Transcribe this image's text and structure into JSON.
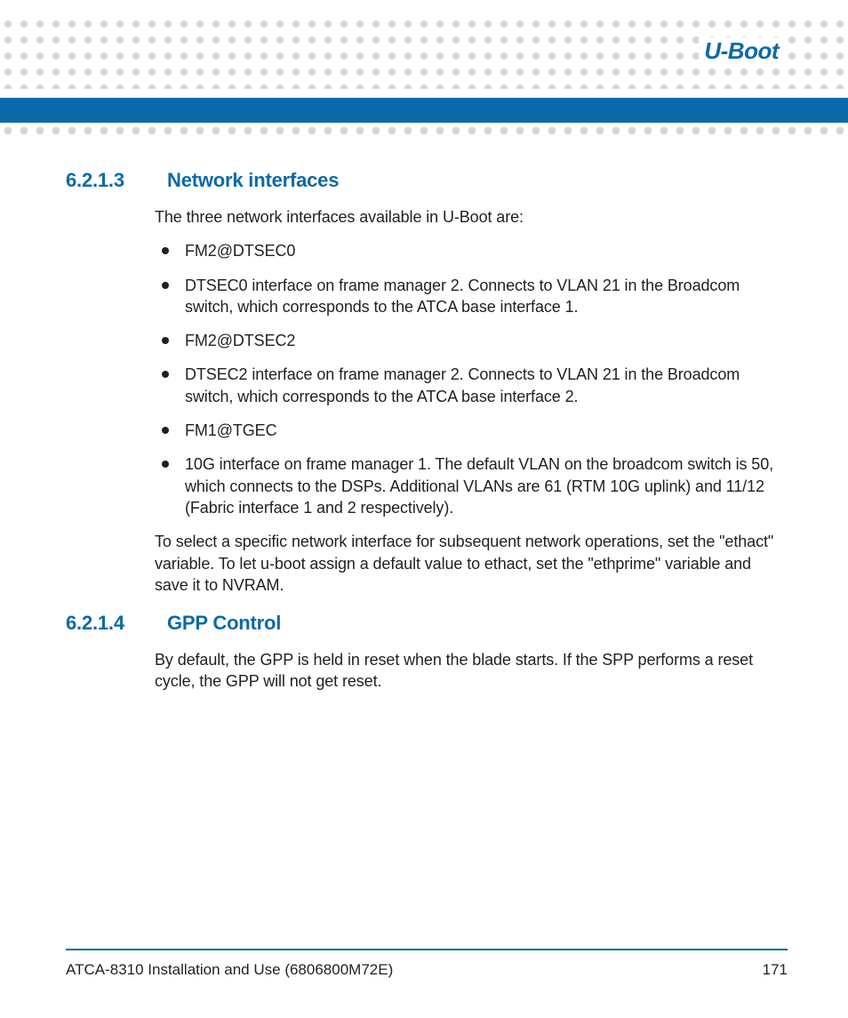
{
  "header": {
    "title": "U-Boot"
  },
  "sections": [
    {
      "number": "6.2.1.3",
      "title": "Network interfaces",
      "intro": "The three network interfaces available in U-Boot are:",
      "bullets": [
        "FM2@DTSEC0",
        "DTSEC0 interface on frame manager 2. Connects to VLAN 21 in the Broadcom switch, which corresponds to the ATCA base interface 1.",
        "FM2@DTSEC2",
        "DTSEC2 interface on frame manager 2. Connects to VLAN 21 in the Broadcom switch, which corresponds to the ATCA base interface 2.",
        "FM1@TGEC",
        "10G interface on frame manager 1. The default VLAN on the broadcom switch is 50, which connects to the DSPs. Additional VLANs are 61 (RTM 10G uplink) and 11/12 (Fabric interface 1 and 2 respectively)."
      ],
      "outro": "To select a specific network interface for subsequent network operations, set the \"ethact\" variable. To let u-boot assign a default value to ethact, set the \"ethprime\" variable and save it to NVRAM."
    },
    {
      "number": "6.2.1.4",
      "title": "GPP Control",
      "intro": "By default, the GPP is held in reset when the blade starts. If the SPP performs a reset cycle, the GPP will not get reset.",
      "bullets": [],
      "outro": ""
    }
  ],
  "footer": {
    "doc": "ATCA-8310 Installation and Use (6806800M72E)",
    "page": "171"
  }
}
